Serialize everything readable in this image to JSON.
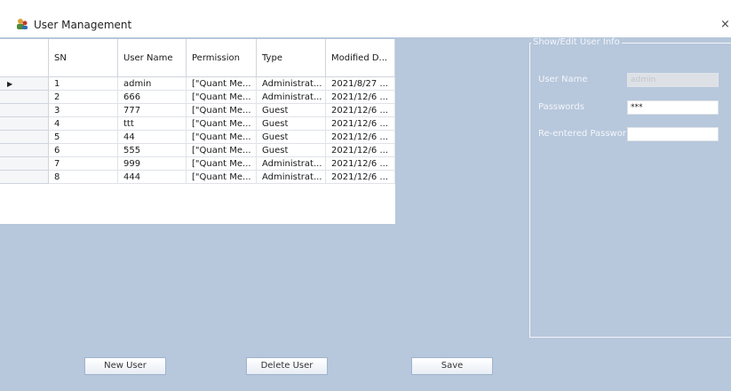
{
  "window": {
    "title": "User Management",
    "close_glyph": "×"
  },
  "grid": {
    "columns": [
      "SN",
      "User Name",
      "Permission",
      "Type",
      "Modified D..."
    ],
    "rows": [
      [
        "1",
        "admin",
        "[\"Quant Me...",
        "Administrat...",
        "2021/8/27 ..."
      ],
      [
        "2",
        "666",
        "[\"Quant Me...",
        "Administrat...",
        "2021/12/6 ..."
      ],
      [
        "3",
        "777",
        "[\"Quant Me...",
        "Guest",
        "2021/12/6 ..."
      ],
      [
        "4",
        "ttt",
        "[\"Quant Me...",
        "Guest",
        "2021/12/6 ..."
      ],
      [
        "5",
        "44",
        "[\"Quant Me...",
        "Guest",
        "2021/12/6 ..."
      ],
      [
        "6",
        "555",
        "[\"Quant Me...",
        "Guest",
        "2021/12/6 ..."
      ],
      [
        "7",
        "999",
        "[\"Quant Me...",
        "Administrat...",
        "2021/12/6 ..."
      ],
      [
        "8",
        "444",
        "[\"Quant Me...",
        "Administrat...",
        "2021/12/6 ..."
      ]
    ],
    "current_row_marker": "▶"
  },
  "info_panel": {
    "title": "Show/Edit User Info",
    "user_name_label": "User Name",
    "user_name_value": "admin",
    "passwords_label": "Passwords",
    "passwords_value": "***",
    "reentered_label": "Re-entered Passwor",
    "reentered_value": ""
  },
  "buttons": {
    "new_user": "New User",
    "delete_user": "Delete User",
    "save": "Save"
  }
}
